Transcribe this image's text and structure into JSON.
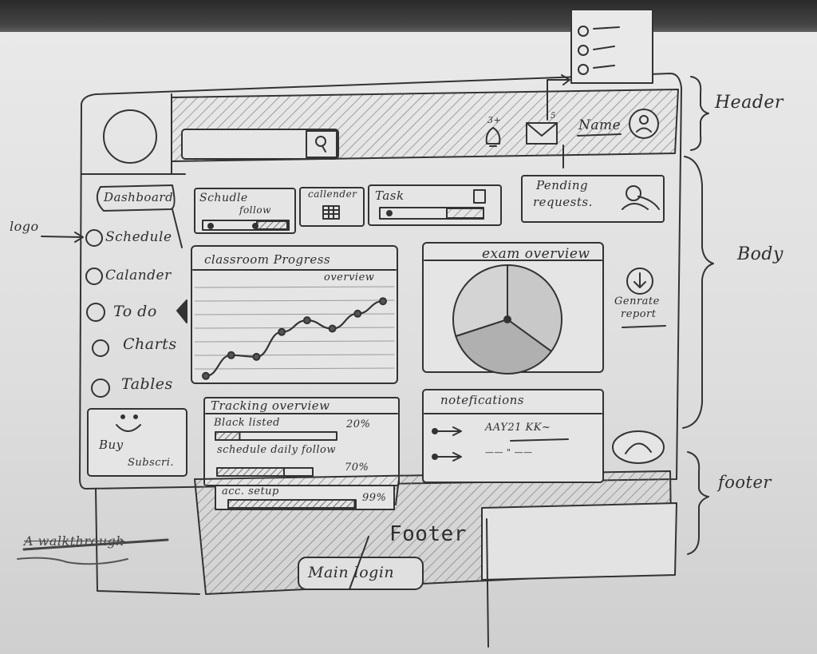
{
  "annotations": {
    "header": "Header",
    "body": "Body",
    "footer": "footer",
    "logo": "logo"
  },
  "header": {
    "notification_count": "3+",
    "mail_count": "5",
    "user_name": "Name"
  },
  "sidebar": {
    "items": [
      {
        "label": "Dashboard"
      },
      {
        "label": "Schedule"
      },
      {
        "label": "Calander"
      },
      {
        "label": "To do"
      },
      {
        "label": "Charts"
      },
      {
        "label": "Tables"
      }
    ],
    "promo": {
      "line1": "Buy",
      "line2": "Subscri."
    }
  },
  "cards": {
    "schedule_follow": {
      "line1": "Schudle",
      "line2": "follow"
    },
    "calendar": "callender",
    "task": "Task",
    "pending": {
      "line1": "Pending",
      "line2": "requests."
    }
  },
  "classroom": {
    "title": "classroom Progress",
    "subtitle": "overview"
  },
  "chart_data": {
    "type": "line",
    "title": "classroom Progress",
    "subtitle": "overview",
    "x": [
      1,
      2,
      3,
      4,
      5,
      6,
      7,
      8
    ],
    "y": [
      5,
      30,
      28,
      58,
      72,
      62,
      80,
      95
    ],
    "xlabel": "",
    "ylabel": "",
    "grid": true
  },
  "exam": {
    "title": "exam overview",
    "slices": [
      {
        "value": 35,
        "fill": "#c8c8c8"
      },
      {
        "value": 35,
        "fill": "#b0b0b0"
      },
      {
        "value": 30,
        "fill": "#d4d4d4"
      }
    ]
  },
  "report": {
    "line1": "Genrate",
    "line2": "report"
  },
  "tracking": {
    "title": "Tracking overview",
    "rows": [
      {
        "label": "Black listed",
        "value": "20%",
        "fraction": 0.2
      },
      {
        "label": "schedule daily follow",
        "value": "70%",
        "fraction": 0.7
      },
      {
        "label": "acc. setup",
        "value": "99%",
        "fraction": 0.99
      }
    ]
  },
  "notifications": {
    "title": "notefications",
    "items": [
      {
        "text": "AAY21 KK~"
      },
      {
        "text": "—— \" ——"
      }
    ]
  },
  "footer": {
    "label": "Footer",
    "button": "Main login",
    "crossed_note": "A walkthrough"
  }
}
